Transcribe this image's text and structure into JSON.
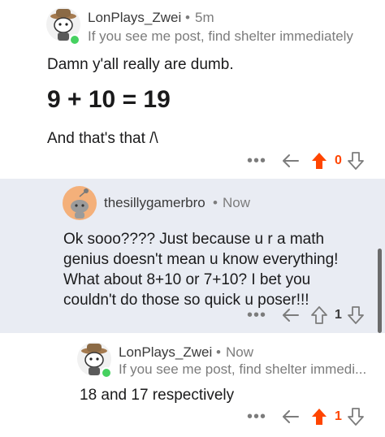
{
  "comments": [
    {
      "username": "LonPlays_Zwei",
      "separator": "•",
      "time": "5m",
      "flair": "If you see me post, find shelter immediately",
      "body_lines": [
        "Damn y'all really are dumb."
      ],
      "big_line": "9 + 10 = 19",
      "closing_line": "And that's that /\\",
      "score": "0",
      "vote_color": "#ff4500"
    },
    {
      "username": "thesillygamerbro",
      "separator": "•",
      "time": "Now",
      "body_lines": [
        "Ok sooo???? Just because u r a math",
        "genius doesn't mean u know everything!",
        "What about 8+10 or 7+10? I bet you",
        "couldn't do those so quick u poser!!!"
      ],
      "score": "1",
      "vote_color": "#7c7c7c"
    },
    {
      "username": "LonPlays_Zwei",
      "separator": "•",
      "time": "Now",
      "flair": "If you see me post, find shelter immedi...",
      "body_lines": [
        "18 and 17 respectively"
      ],
      "score": "1",
      "vote_color": "#ff4500"
    }
  ],
  "icons": {
    "more": "more-dots-icon",
    "reply": "reply-arrow-icon",
    "upvote": "upvote-arrow-icon",
    "downvote": "downvote-arrow-icon"
  },
  "colors": {
    "upvote_active": "#ff4500",
    "highlight_background": "#e9ecf3",
    "online_dot": "#46d160",
    "avatar_orange": "#f4b07a"
  },
  "more_label": "•••"
}
